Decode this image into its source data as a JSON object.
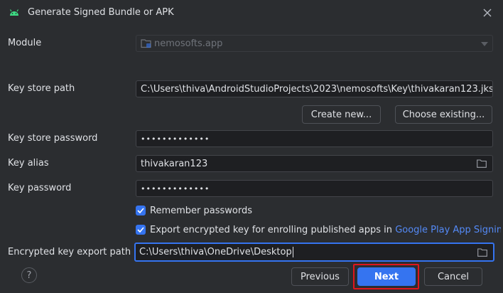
{
  "window": {
    "title": "Generate Signed Bundle or APK"
  },
  "form": {
    "module_label": "Module",
    "module_value": "nemosofts.app",
    "key_store_path_label": "Key store path",
    "key_store_path_value": "C:\\Users\\thiva\\AndroidStudioProjects\\2023\\nemosofts\\Key\\thivakaran123.jks",
    "create_new_label": "Create new...",
    "choose_existing_label": "Choose existing...",
    "key_store_password_label": "Key store password",
    "key_store_password_value": "•••••••••••••",
    "key_alias_label": "Key alias",
    "key_alias_value": "thivakaran123",
    "key_password_label": "Key password",
    "key_password_value": "•••••••••••••",
    "remember_passwords_label": "Remember passwords",
    "remember_passwords_checked": true,
    "export_key_label": "Export encrypted key for enrolling published apps in",
    "export_key_link": "Google Play App Signing",
    "export_key_checked": true,
    "export_path_label": "Encrypted key export path",
    "export_path_value": "C:\\Users\\thiva\\OneDrive\\Desktop"
  },
  "footer": {
    "help_label": "?",
    "previous_label": "Previous",
    "next_label": "Next",
    "cancel_label": "Cancel"
  },
  "icons": {
    "app": "android-icon",
    "close": "close-icon",
    "module": "module-folder-icon",
    "dropdown": "chevron-down-icon",
    "browse": "folder-icon",
    "checkbox": "checkmark-icon",
    "help": "question-icon"
  },
  "colors": {
    "background": "#2b2d30",
    "field_background": "#1e1f22",
    "accent": "#3574f0",
    "link": "#548af7",
    "android_green": "#3ddc84",
    "highlight": "#e0161c"
  }
}
